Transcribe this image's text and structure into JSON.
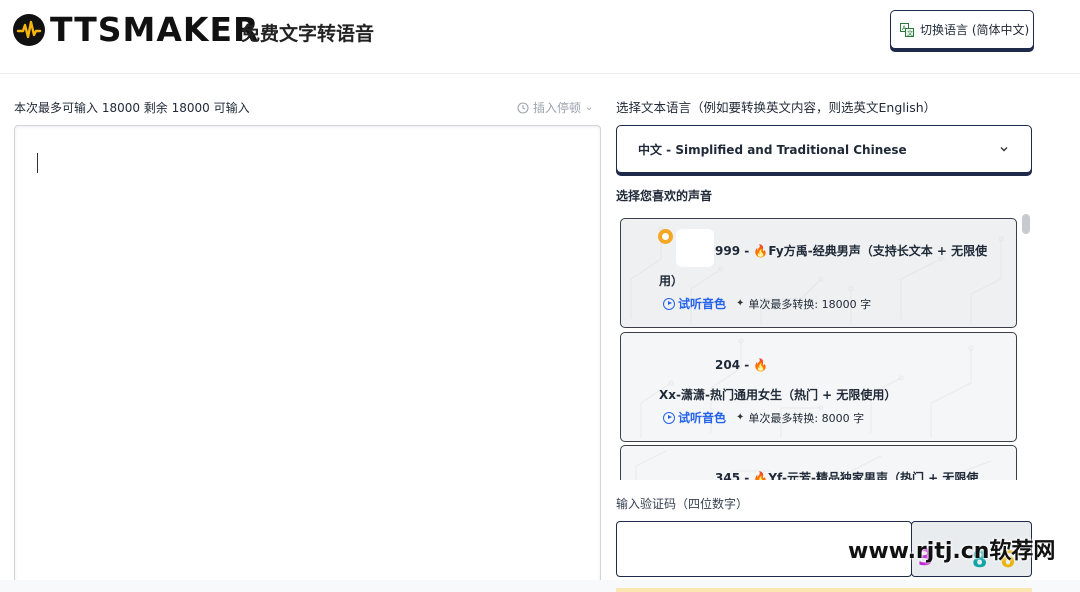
{
  "header": {
    "brand": "TTSMAKER",
    "subtitle": "免费文字转语音",
    "language_button": "切换语言 (简体中文)"
  },
  "editor": {
    "label": "本次最多可输入 18000 剩余 18000 可输入",
    "pause_button": "插入停顿",
    "text": ""
  },
  "language": {
    "label": "选择文本语言（例如要转换英文内容，则选英文English）",
    "selected": "中文 - Simplified and Traditional Chinese"
  },
  "voices": {
    "label": "选择您喜欢的声音",
    "items": [
      {
        "id": "999",
        "prefix": "999 - ",
        "name": "Fy方禹-经典男声（支持长文本 + 无限使用）",
        "listen": "试听音色",
        "limit": "单次最多转换: 18000 字",
        "selected": true
      },
      {
        "id": "204",
        "prefix": "204 - ",
        "name": "Xx-潇潇-热门通用女生（热门 + 无限使用）",
        "listen": "试听音色",
        "limit": "单次最多转换: 8000 字",
        "selected": false
      },
      {
        "id": "345",
        "prefix": "345 - ",
        "name": "Yf-元芳-精品独家男声（热门 + 无限使",
        "listen": "试听音色",
        "limit": "",
        "selected": false
      }
    ]
  },
  "captcha": {
    "label": "输入验证码（四位数字）",
    "value": ""
  },
  "watermark": "www.rjtj.cn软荐网",
  "colors": {
    "accent_orange": "#f5a623",
    "link_blue": "#2563eb",
    "border_navy": "#1e2a4a"
  },
  "icons": {
    "logo": "waveform-icon",
    "language": "translate-icon",
    "pause": "clock-icon",
    "dropdown": "chevron-down-icon",
    "radio": "radio-selected-icon",
    "hot": "flame-icon",
    "play": "play-circle-icon",
    "limit": "sparkle-icon"
  }
}
